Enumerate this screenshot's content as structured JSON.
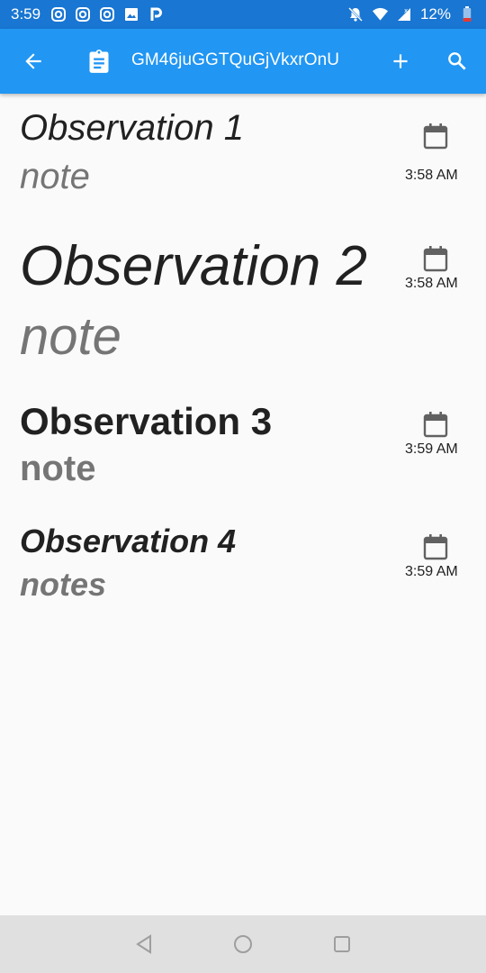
{
  "status_bar": {
    "time": "3:59",
    "battery": "12%",
    "notification_icons": [
      "instagram-icon",
      "instagram-icon",
      "instagram-icon",
      "image-icon",
      "p-app-icon"
    ],
    "system_icons": [
      "notifications-off-icon",
      "wifi-icon",
      "signal-icon",
      "battery-low-icon"
    ]
  },
  "app_bar": {
    "title": "GM46juGGTQuGjVkxrOnU",
    "icons": [
      "back-arrow-icon",
      "clipboard-icon",
      "add-icon",
      "search-icon"
    ],
    "color": "#2196f3"
  },
  "observations": [
    {
      "title": "Observation 1",
      "note": "note",
      "time": "3:58 AM"
    },
    {
      "title": "Observation 2",
      "note": "note",
      "time": "3:58 AM"
    },
    {
      "title": "Observation 3",
      "note": "note",
      "time": "3:59 AM"
    },
    {
      "title": "Observation 4",
      "note": "notes",
      "time": "3:59 AM"
    }
  ],
  "nav_bar": {
    "icons": [
      "nav-back-icon",
      "nav-home-icon",
      "nav-recents-icon"
    ]
  }
}
